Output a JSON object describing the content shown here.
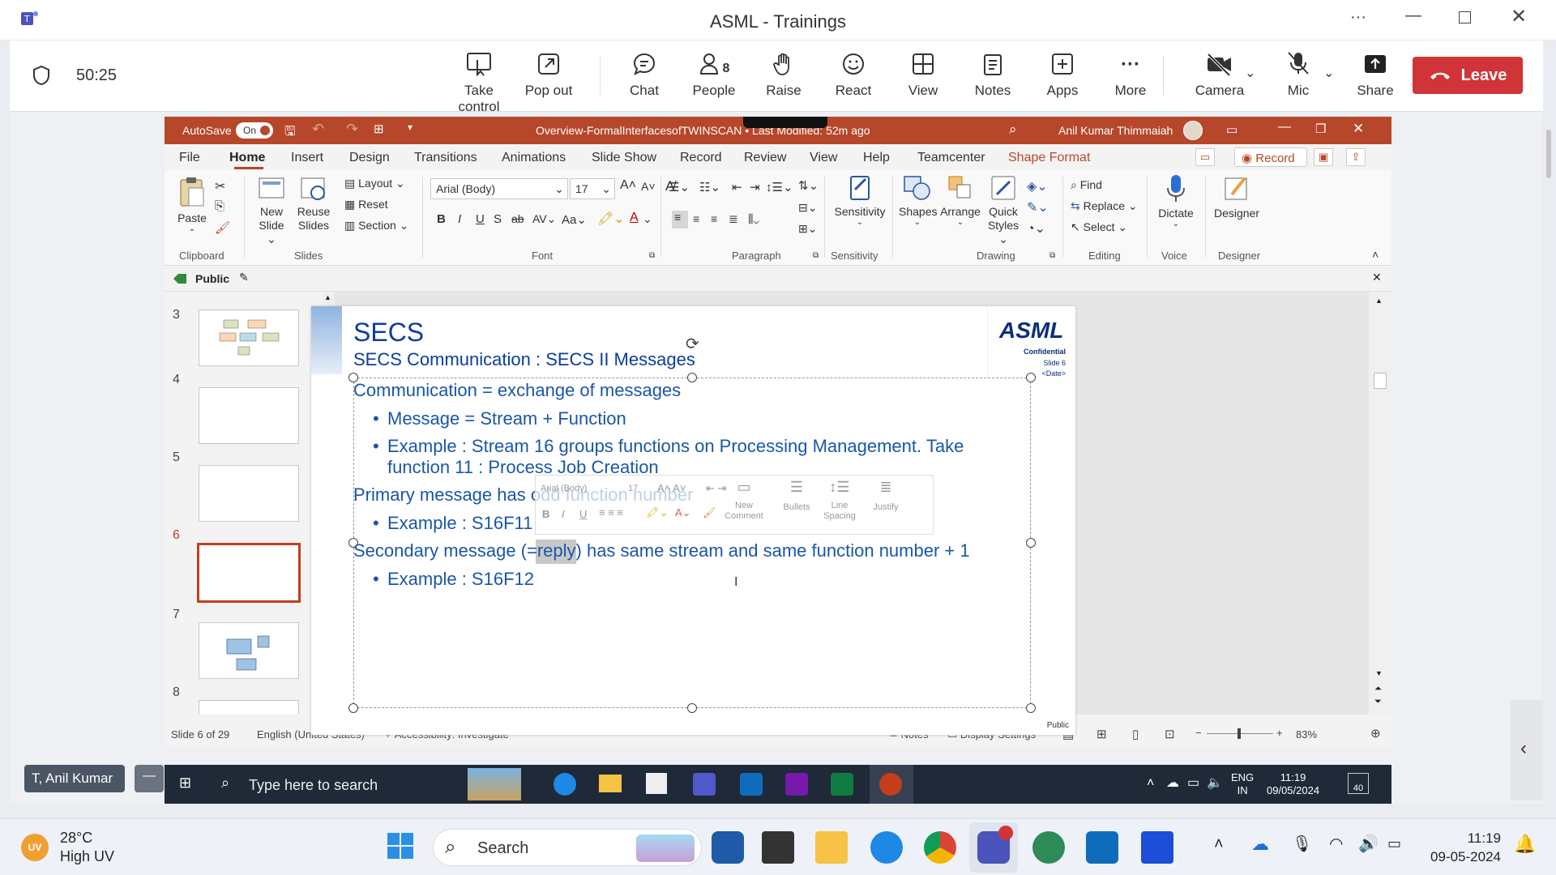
{
  "teams": {
    "window_title": "ASML - Trainings",
    "timer": "50:25",
    "buttons": [
      {
        "label": "Take control",
        "icon": "take-control-icon"
      },
      {
        "label": "Pop out",
        "icon": "pop-out-icon"
      },
      {
        "label": "Chat",
        "icon": "chat-icon"
      },
      {
        "label": "People",
        "icon": "people-icon",
        "count": "8"
      },
      {
        "label": "Raise",
        "icon": "raise-hand-icon"
      },
      {
        "label": "React",
        "icon": "react-icon"
      },
      {
        "label": "View",
        "icon": "view-icon"
      },
      {
        "label": "Notes",
        "icon": "notes-icon"
      },
      {
        "label": "Apps",
        "icon": "apps-icon"
      },
      {
        "label": "More",
        "icon": "more-icon"
      },
      {
        "label": "Camera",
        "icon": "camera-off-icon"
      },
      {
        "label": "Mic",
        "icon": "mic-off-icon"
      },
      {
        "label": "Share",
        "icon": "share-icon"
      }
    ],
    "leave_label": "Leave",
    "presenter_name": "T, Anil Kumar",
    "colors": {
      "leave": "#d13438",
      "brand": "#4b53bc"
    }
  },
  "ppt": {
    "autosave_label": "AutoSave",
    "autosave_state": "On",
    "doc_title": "Overview-FormalInterfacesofTWINSCAN • Last Modified: 52m ago",
    "user_name": "Anil Kumar Thimmaiah",
    "tabs": [
      "File",
      "Home",
      "Insert",
      "Design",
      "Transitions",
      "Animations",
      "Slide Show",
      "Record",
      "Review",
      "View",
      "Help",
      "Teamcenter",
      "Shape Format"
    ],
    "active_tab": "Home",
    "record_label": "Record",
    "ribbon": {
      "clipboard": {
        "paste": "Paste",
        "label": "Clipboard"
      },
      "slides": {
        "new_slide": "New Slide",
        "reuse": "Reuse Slides",
        "layout": "Layout",
        "reset": "Reset",
        "section": "Section",
        "label": "Slides"
      },
      "font": {
        "name": "Arial (Body)",
        "size": "17",
        "label": "Font"
      },
      "paragraph_label": "Paragraph",
      "sensitivity": {
        "button": "Sensitivity",
        "label": "Sensitivity"
      },
      "drawing": {
        "shapes": "Shapes",
        "arrange": "Arrange",
        "quick_styles": "Quick Styles",
        "label": "Drawing"
      },
      "editing": {
        "find": "Find",
        "replace": "Replace",
        "select": "Select",
        "label": "Editing"
      },
      "voice": {
        "dictate": "Dictate",
        "label": "Voice"
      },
      "designer": {
        "button": "Designer",
        "label": "Designer"
      }
    },
    "sensitivity_tag": "Public",
    "thumbnails": [
      {
        "num": "3",
        "selected": false
      },
      {
        "num": "4",
        "selected": false
      },
      {
        "num": "5",
        "selected": false
      },
      {
        "num": "6",
        "selected": true
      },
      {
        "num": "7",
        "selected": false
      },
      {
        "num": "8",
        "selected": false
      }
    ],
    "slide": {
      "title": "SECS",
      "subtitle": "SECS Communication : SECS II Messages",
      "logo": "ASML",
      "confidential": "Confidential",
      "slide_no": "Slide 6",
      "date": "<Date>",
      "footer": "Public",
      "lines": [
        {
          "level": 0,
          "text": "Communication = exchange of messages"
        },
        {
          "level": 1,
          "text": "Message = Stream + Function"
        },
        {
          "level": 1,
          "text": "Example : Stream 16 groups functions on Processing Management.  Take"
        },
        {
          "level": 1,
          "text": "function 11 : Process Job Creation"
        },
        {
          "level": 0,
          "text": "Primary message has odd function number"
        },
        {
          "level": 1,
          "text": "Example : S16F11"
        },
        {
          "level": 0,
          "text": "Secondary message (=reply) has same stream and same function number + 1"
        },
        {
          "level": 1,
          "text": "Example : S16F12"
        }
      ]
    },
    "mini_toolbar": {
      "font": "Arial (Body)",
      "size": "17",
      "new_comment": "New Comment",
      "bullets": "Bullets",
      "line_spacing": "Line Spacing",
      "justify": "Justify"
    },
    "status": {
      "slide_of": "Slide 6 of 29",
      "language": "English (United States)",
      "accessibility": "Accessibility: Investigate",
      "notes": "Notes",
      "display_settings": "Display Settings",
      "zoom": "83%"
    }
  },
  "vm_taskbar": {
    "search_placeholder": "Type here to search",
    "lang": "ENG",
    "region": "IN",
    "time": "11:19",
    "date": "09/05/2024",
    "notif_count": "40"
  },
  "host_taskbar": {
    "weather_temp": "28°C",
    "weather_desc": "High UV",
    "search_label": "Search",
    "time": "11:19",
    "date": "09-05-2024"
  }
}
